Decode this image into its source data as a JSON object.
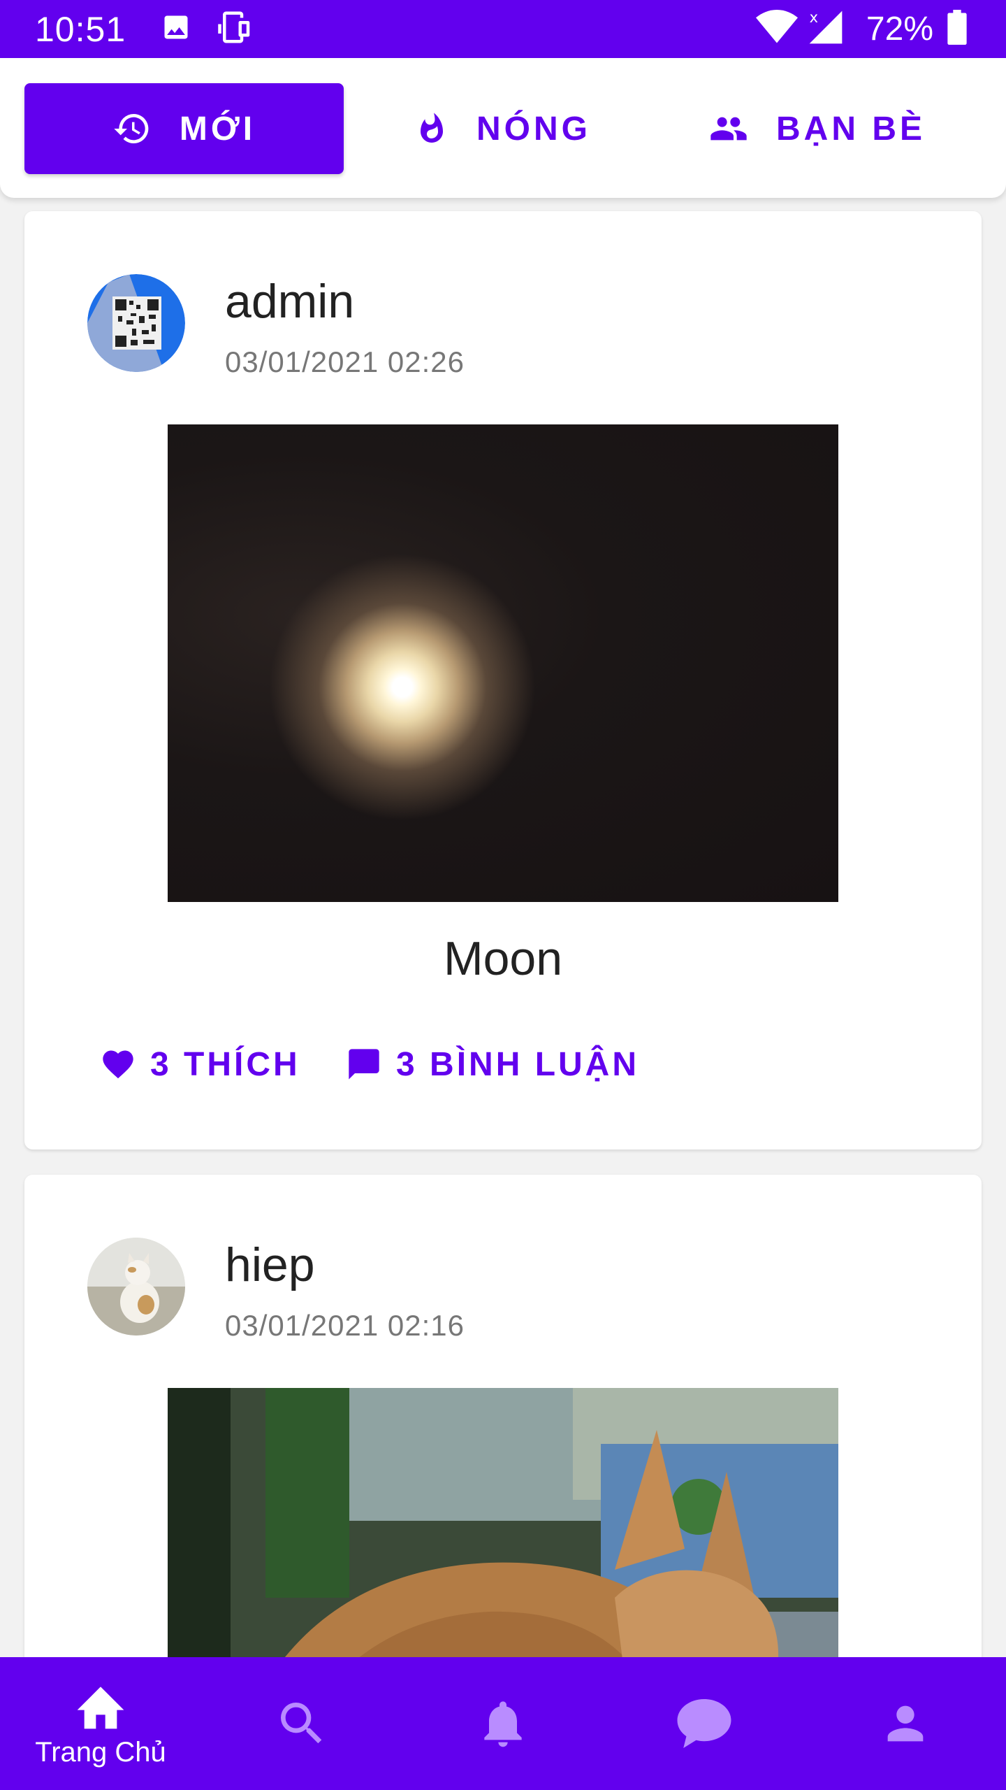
{
  "status_bar": {
    "time": "10:51",
    "battery": "72%",
    "icons": [
      "image-icon",
      "device-icon",
      "wifi-icon",
      "signal-icon",
      "battery-icon"
    ]
  },
  "tabs": [
    {
      "label": "MỚI",
      "icon": "history-icon",
      "active": true
    },
    {
      "label": "NÓNG",
      "icon": "fire-icon",
      "active": false
    },
    {
      "label": "BẠN BÈ",
      "icon": "people-icon",
      "active": false
    }
  ],
  "posts": [
    {
      "author": "admin",
      "time": "03/01/2021 02:26",
      "caption": "Moon",
      "likes": "3 THÍCH",
      "comments": "3 BÌNH LUẬN"
    },
    {
      "author": "hiep",
      "time": "03/01/2021 02:16"
    }
  ],
  "bottom_nav": [
    {
      "label": "Trang Chủ",
      "icon": "home-icon",
      "active": true
    },
    {
      "label": "",
      "icon": "search-icon",
      "active": false
    },
    {
      "label": "",
      "icon": "bell-icon",
      "active": false
    },
    {
      "label": "",
      "icon": "chat-icon",
      "active": false
    },
    {
      "label": "",
      "icon": "person-icon",
      "active": false
    }
  ],
  "colors": {
    "primary": "#6200ee",
    "nav_inactive": "#b98cff"
  }
}
